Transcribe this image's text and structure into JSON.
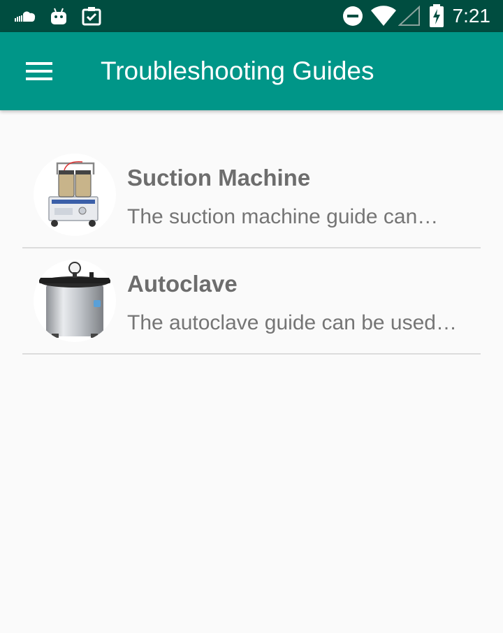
{
  "status_bar": {
    "time": "7:21",
    "icons": [
      "cloud-icon",
      "android-icon",
      "clipboard-check-icon",
      "do-not-disturb-icon",
      "wifi-icon",
      "signal-icon",
      "battery-charging-icon"
    ]
  },
  "app_bar": {
    "title": "Troubleshooting Guides",
    "menu_icon": "hamburger-menu-icon"
  },
  "guides": [
    {
      "title": "Suction Machine",
      "description": "The suction machine guide can…",
      "image": "suction-machine-image"
    },
    {
      "title": "Autoclave",
      "description": "The autoclave guide can be used…",
      "image": "autoclave-image"
    }
  ],
  "colors": {
    "status_bar": "#004d40",
    "app_bar": "#009688",
    "background": "#fafafa",
    "title_text": "#6d6d6d",
    "desc_text": "#757575",
    "divider": "#dcdcdc"
  }
}
